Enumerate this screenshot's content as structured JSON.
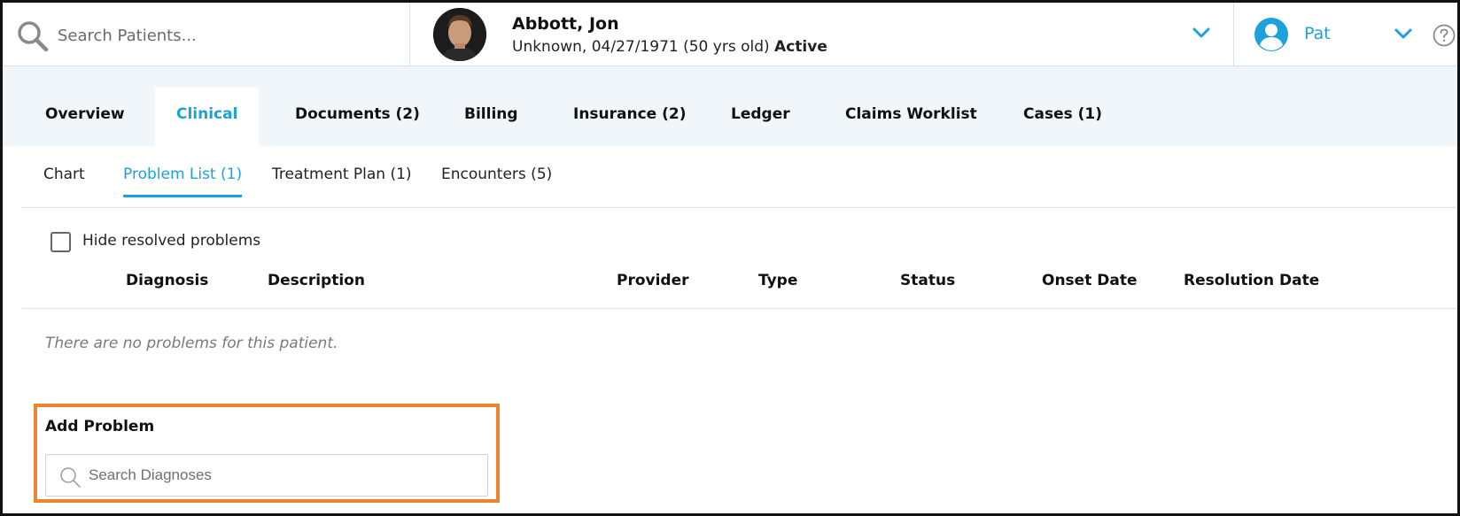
{
  "search": {
    "placeholder": "Search Patients..."
  },
  "patient": {
    "name": "Abbott, Jon",
    "details": "Unknown, 04/27/1971 (50 yrs old)",
    "status": "Active"
  },
  "user": {
    "name": "Pat"
  },
  "main_tabs": [
    {
      "label": "Overview",
      "active": false
    },
    {
      "label": "Clinical",
      "active": true
    },
    {
      "label": "Documents (2)",
      "active": false
    },
    {
      "label": "Billing",
      "active": false
    },
    {
      "label": "Insurance (2)",
      "active": false
    },
    {
      "label": "Ledger",
      "active": false
    },
    {
      "label": "Claims Worklist",
      "active": false
    },
    {
      "label": "Cases (1)",
      "active": false
    }
  ],
  "sub_tabs": [
    {
      "label": "Chart",
      "active": false
    },
    {
      "label": "Problem List (1)",
      "active": true
    },
    {
      "label": "Treatment Plan (1)",
      "active": false
    },
    {
      "label": "Encounters (5)",
      "active": false
    }
  ],
  "filter": {
    "hide_resolved_label": "Hide resolved problems",
    "checked": false
  },
  "table": {
    "columns": [
      "Diagnosis",
      "Description",
      "Provider",
      "Type",
      "Status",
      "Onset Date",
      "Resolution Date"
    ],
    "empty_message": "There are no problems for this patient."
  },
  "add_problem": {
    "title": "Add Problem",
    "search_placeholder": "Search Diagnoses"
  },
  "colors": {
    "accent": "#1ea0dc",
    "highlight_border": "#f0832f",
    "tab_band": "#f0f6f9"
  }
}
